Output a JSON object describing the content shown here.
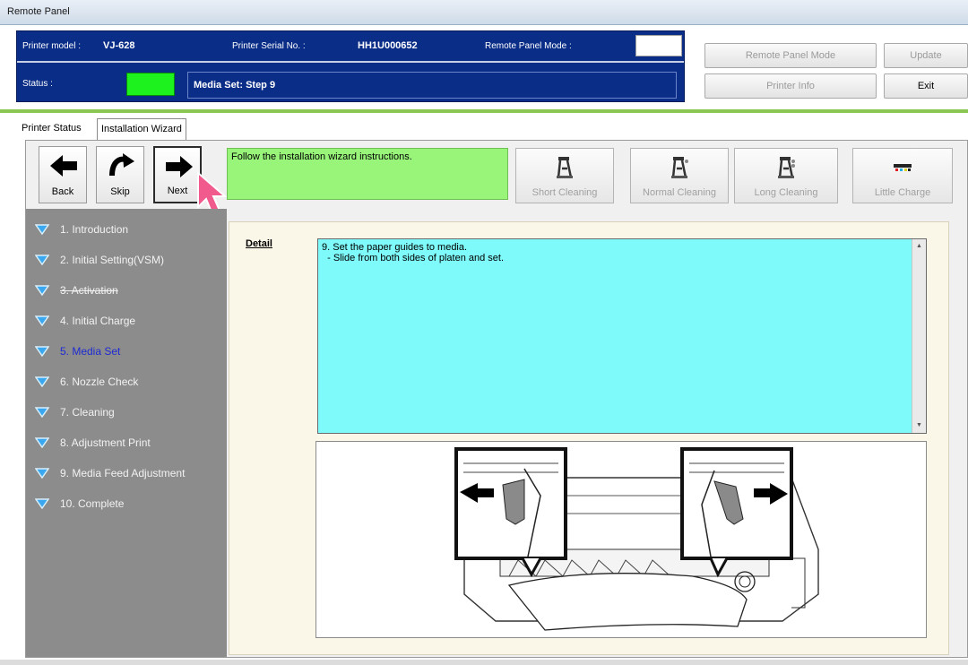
{
  "window": {
    "title": "Remote Panel"
  },
  "header": {
    "printer_model_label": "Printer model :",
    "printer_model": "VJ-628",
    "serial_label": "Printer Serial No. :",
    "serial": "HH1U000652",
    "mode_label": "Remote Panel Mode :",
    "status_label": "Status :",
    "status_text": "Media Set: Step 9",
    "status_color": "#1ef21e"
  },
  "header_buttons": {
    "remote_panel_mode": "Remote Panel Mode",
    "update": "Update",
    "printer_info": "Printer Info",
    "exit": "Exit"
  },
  "tabs": [
    {
      "label": "Printer Status",
      "active": false
    },
    {
      "label": "Installation Wizard",
      "active": true
    }
  ],
  "nav": {
    "back": "Back",
    "skip": "Skip",
    "next": "Next"
  },
  "instruction": "Follow the installation wizard instructions.",
  "tools": {
    "short_cleaning": "Short Cleaning",
    "normal_cleaning": "Normal Cleaning",
    "long_cleaning": "Long Cleaning",
    "little_charge": "Little Charge"
  },
  "steps": [
    {
      "label": "1. Introduction"
    },
    {
      "label": "2. Initial Setting(VSM)"
    },
    {
      "label": "3. Activation",
      "struck": true
    },
    {
      "label": "4. Initial Charge"
    },
    {
      "label": "5. Media Set",
      "current": true
    },
    {
      "label": "6. Nozzle Check"
    },
    {
      "label": "7. Cleaning"
    },
    {
      "label": "8. Adjustment Print"
    },
    {
      "label": "9. Media Feed Adjustment"
    },
    {
      "label": "10. Complete"
    }
  ],
  "detail": {
    "label": "Detail",
    "text": "9. Set the paper guides to media.\n  - Slide from both sides of platen and set."
  },
  "colors": {
    "header_blue": "#0a2d87",
    "accent_green": "#8bc553",
    "instruction_bg": "#98f57a",
    "detail_bg": "#7ffafa",
    "sidebar_bg": "#8c8c8c",
    "step_icon": "#39a8f0",
    "current_step_text": "#1e2bd2",
    "cursor_pink": "#f05a8c"
  },
  "icons": {
    "back": "arrow-left-icon",
    "skip": "curved-arrow-icon",
    "next": "arrow-right-icon",
    "step": "triangle-down-icon",
    "cleaning": "print-head-icon",
    "charge": "ink-cartridge-icon",
    "pointer": "mouse-cursor-icon"
  }
}
